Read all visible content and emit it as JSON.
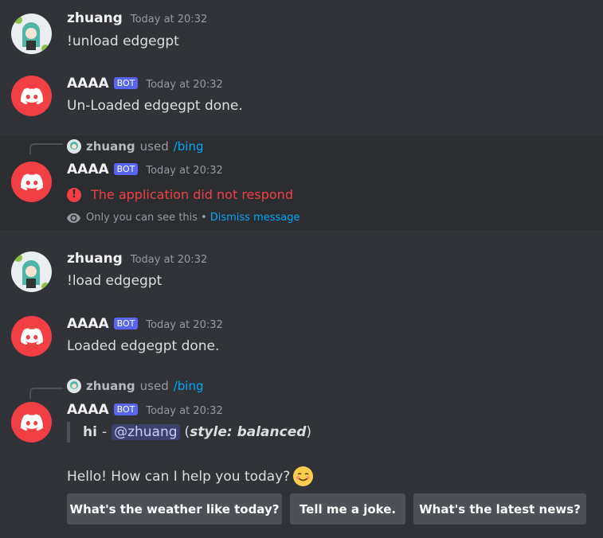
{
  "messages": [
    {
      "author": "zhuang",
      "time": "Today at 20:32",
      "text": "!unload edgegpt"
    },
    {
      "author": "AAAA",
      "badge": "BOT",
      "time": "Today at 20:32",
      "text": "Un-Loaded edgegpt done."
    },
    {
      "reply_user": "zhuang",
      "reply_used": "used",
      "reply_command": "/bing",
      "author": "AAAA",
      "badge": "BOT",
      "time": "Today at 20:32",
      "error_text": "The application did not respond",
      "ephemeral_text": "Only you can see this",
      "separator": "•",
      "dismiss": "Dismiss message"
    },
    {
      "author": "zhuang",
      "time": "Today at 20:32",
      "text": "!load edgegpt"
    },
    {
      "author": "AAAA",
      "badge": "BOT",
      "time": "Today at 20:32",
      "text": "Loaded edgegpt done."
    },
    {
      "reply_user": "zhuang",
      "reply_used": "used",
      "reply_command": "/bing",
      "author": "AAAA",
      "badge": "BOT",
      "time": "Today at 20:32",
      "quote": {
        "prefix": "hi",
        "dash": "-",
        "mention": "@zhuang",
        "style_open": "(",
        "style_label": "style: balanced",
        "style_close": ")"
      },
      "text": "Hello! How can I help you today?",
      "emoji": "smiling-face-emoji",
      "buttons": [
        "What's the weather like today?",
        "Tell me a joke.",
        "What's the latest news?"
      ]
    }
  ],
  "colors": {
    "background": "#313338",
    "highlight": "#2b2d31",
    "bot_badge": "#5865f2",
    "error": "#f23f43",
    "link": "#00a8fc",
    "button": "#4e5058"
  }
}
